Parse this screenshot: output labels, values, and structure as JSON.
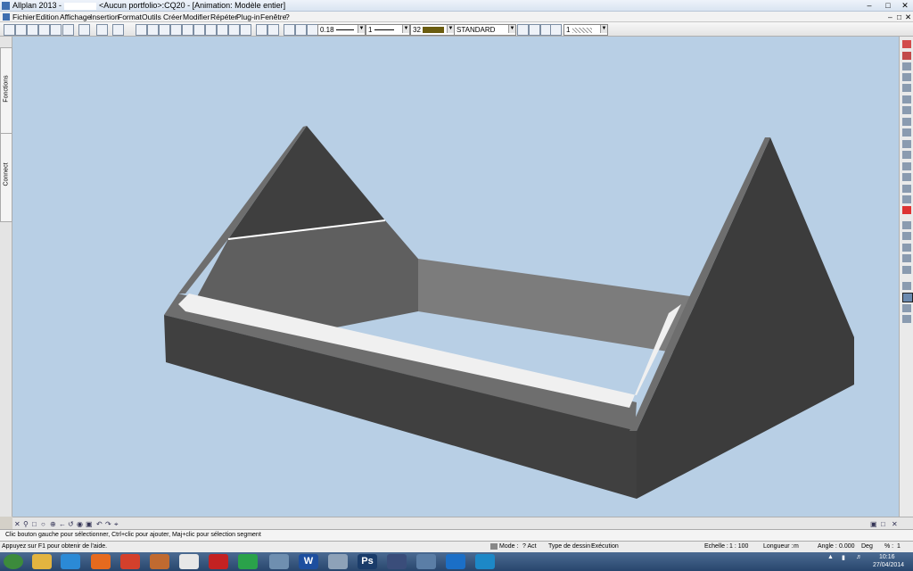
{
  "titlebar": {
    "app": "Allplan 2013 -",
    "rest": "<Aucun portfolio>:CQ20 - [Animation: Modèle entier]"
  },
  "menu": [
    "Fichier",
    "Edition",
    "Affichage",
    "Insertion",
    "Format",
    "Outils",
    "Créer",
    "Modifier",
    "Répéter",
    "Plug-in",
    "Fenêtre",
    "?"
  ],
  "toolbar": {
    "pen": "0.18",
    "line": "1",
    "color_number": "32",
    "color_swatch": "#6b5d10",
    "layer": "STANDARD",
    "pattern": "1"
  },
  "side_tabs": [
    "Fonctions",
    "Connect"
  ],
  "hint": "Clic bouton gauche pour sélectionner, Ctrl+clic pour ajouter, Maj+clic pour sélection segment",
  "status": {
    "help": "Appuyez sur F1 pour obtenir de l'aide.",
    "mode_label": "Mode :",
    "mode_value": "? Act",
    "drawing_type_label": "Type de dessin :",
    "drawing_type_value": "Exécution",
    "scale_label": "Echelle :",
    "scale_value": "1 : 100",
    "length_label": "Longueur :",
    "length_value": "m",
    "angle_label": "Angle :",
    "angle_value": "0.000",
    "angle_unit": "Deg",
    "percent_label": "% :",
    "percent_value": "1"
  },
  "taskbar": {
    "time": "10:16",
    "date": "27/04/2014",
    "apps": [
      {
        "icon": "start-orb-icon",
        "color": "#3c8b3c"
      },
      {
        "icon": "folder-icon",
        "color": "#e3b440"
      },
      {
        "icon": "ie-icon",
        "color": "#2b8ad6"
      },
      {
        "icon": "firefox-icon",
        "color": "#e66a1e"
      },
      {
        "icon": "chrome-icon",
        "color": "#d4402c"
      },
      {
        "icon": "paint-icon",
        "color": "#c06a30"
      },
      {
        "icon": "media-player-icon",
        "color": "#e7e7e7"
      },
      {
        "icon": "ccleaner-icon",
        "color": "#c42222"
      },
      {
        "icon": "compass-icon",
        "color": "#2aa24a"
      },
      {
        "icon": "settings-icon",
        "color": "#6f8fb0"
      },
      {
        "icon": "word-icon",
        "color": "#1d4f9f"
      },
      {
        "icon": "monitor-icon",
        "color": "#8ea2b8"
      },
      {
        "icon": "photoshop-icon",
        "color": "#1a3c6a"
      },
      {
        "icon": "cinema4d-icon",
        "color": "#3a4d7a"
      },
      {
        "icon": "allplan-icon",
        "color": "#5b7ea6"
      },
      {
        "icon": "teamviewer-icon",
        "color": "#1b6fc7"
      },
      {
        "icon": "plane-icon",
        "color": "#1d88c7"
      }
    ]
  }
}
